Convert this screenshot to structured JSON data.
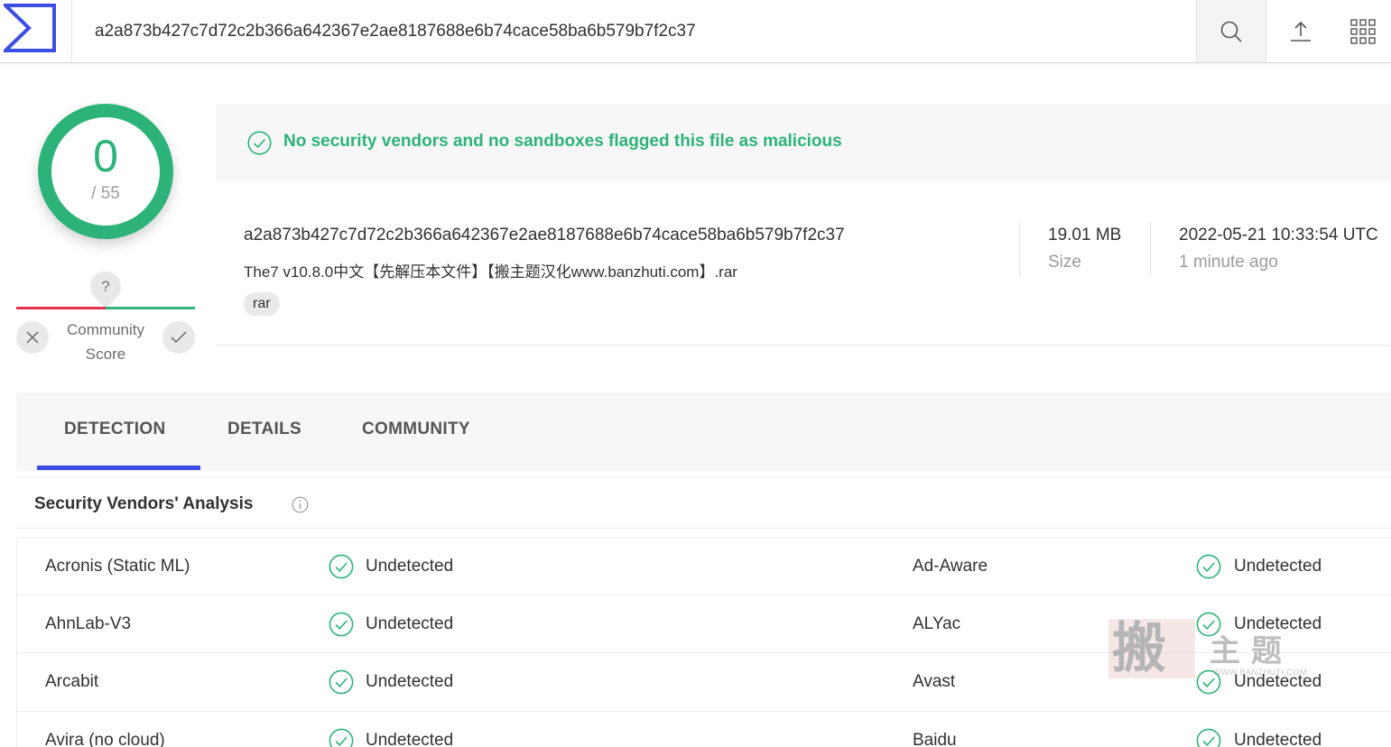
{
  "search": {
    "value": "a2a873b427c7d72c2b366a642367e2ae8187688e6b74cace58ba6b579b7f2c37"
  },
  "topbar": {
    "icons": [
      "virustotal-logo",
      "search-icon",
      "upload-icon",
      "apps-grid-icon"
    ]
  },
  "score": {
    "detected": "0",
    "total": "/ 55",
    "color": "#2db37a"
  },
  "community": {
    "question": "?",
    "label_line1": "Community",
    "label_line2": "Score"
  },
  "banner": {
    "message": "No security vendors and no sandboxes flagged this file as malicious"
  },
  "file": {
    "hash": "a2a873b427c7d72c2b366a642367e2ae8187688e6b74cace58ba6b579b7f2c37",
    "name": "The7 v10.8.0中文【先解压本文件】【搬主题汉化www.banzhuti.com】.rar",
    "tag": "rar",
    "size": "19.01 MB",
    "size_label": "Size",
    "date": "2022-05-21 10:33:54 UTC",
    "date_relative": "1 minute ago"
  },
  "tabs": [
    {
      "label": "DETECTION",
      "active": true
    },
    {
      "label": "DETAILS",
      "active": false
    },
    {
      "label": "COMMUNITY",
      "active": false
    }
  ],
  "section": {
    "title": "Security Vendors' Analysis"
  },
  "vendors": [
    {
      "left": "Acronis (Static ML)",
      "left_result": "Undetected",
      "right": "Ad-Aware",
      "right_result": "Undetected"
    },
    {
      "left": "AhnLab-V3",
      "left_result": "Undetected",
      "right": "ALYac",
      "right_result": "Undetected"
    },
    {
      "left": "Arcabit",
      "left_result": "Undetected",
      "right": "Avast",
      "right_result": "Undetected"
    },
    {
      "left": "Avira (no cloud)",
      "left_result": "Undetected",
      "right": "Baidu",
      "right_result": "Undetected"
    }
  ],
  "watermark": {
    "big": "搬",
    "small": "主题",
    "url": "WWW.BANZHUTI.COM"
  },
  "colors": {
    "accent": "#3b4fe4",
    "clean": "#2db37a",
    "malicious": "#e4324f"
  }
}
